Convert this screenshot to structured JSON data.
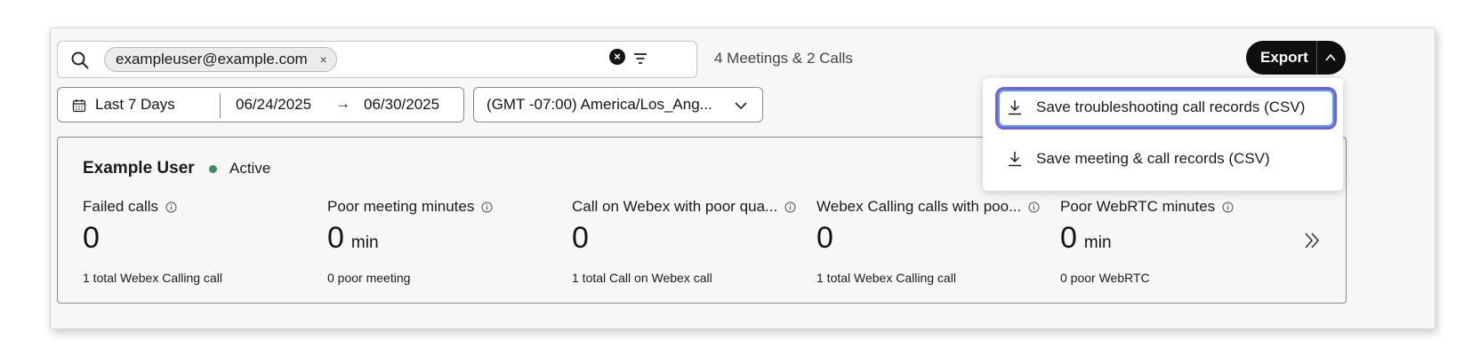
{
  "search": {
    "chip_label": "exampleuser@example.com",
    "chip_remove": "×",
    "clear": "×"
  },
  "summary": {
    "count": "4 Meetings & 2 Calls"
  },
  "date_range": {
    "preset": "Last 7 Days",
    "start": "06/24/2025",
    "arrow": "→",
    "end": "06/30/2025"
  },
  "timezone": {
    "selected": "(GMT -07:00) America/Los_Ang..."
  },
  "export": {
    "label": "Export",
    "menu": [
      {
        "label": "Save troubleshooting call records (CSV)"
      },
      {
        "label": "Save meeting & call records (CSV)"
      }
    ]
  },
  "user": {
    "name": "Example User",
    "status": "Active",
    "status_color": "#3f8f5f"
  },
  "metrics": [
    {
      "title": "Failed calls",
      "value": "0",
      "unit": "",
      "sub": "1 total Webex Calling call"
    },
    {
      "title": "Poor meeting minutes",
      "value": "0",
      "unit": "min",
      "sub": "0 poor meeting"
    },
    {
      "title": "Call on Webex with poor qua...",
      "value": "0",
      "unit": "",
      "sub": "1 total Call on Webex call"
    },
    {
      "title": "Webex Calling calls with poo...",
      "value": "0",
      "unit": "",
      "sub": "1 total Webex Calling call"
    },
    {
      "title": "Poor WebRTC minutes",
      "value": "0",
      "unit": "min",
      "sub": "0 poor WebRTC"
    }
  ],
  "colors": {
    "accent_focus": "#7b5cd6",
    "focus_ring": "#4aa3e6",
    "button_dark": "#0f0f0f"
  }
}
